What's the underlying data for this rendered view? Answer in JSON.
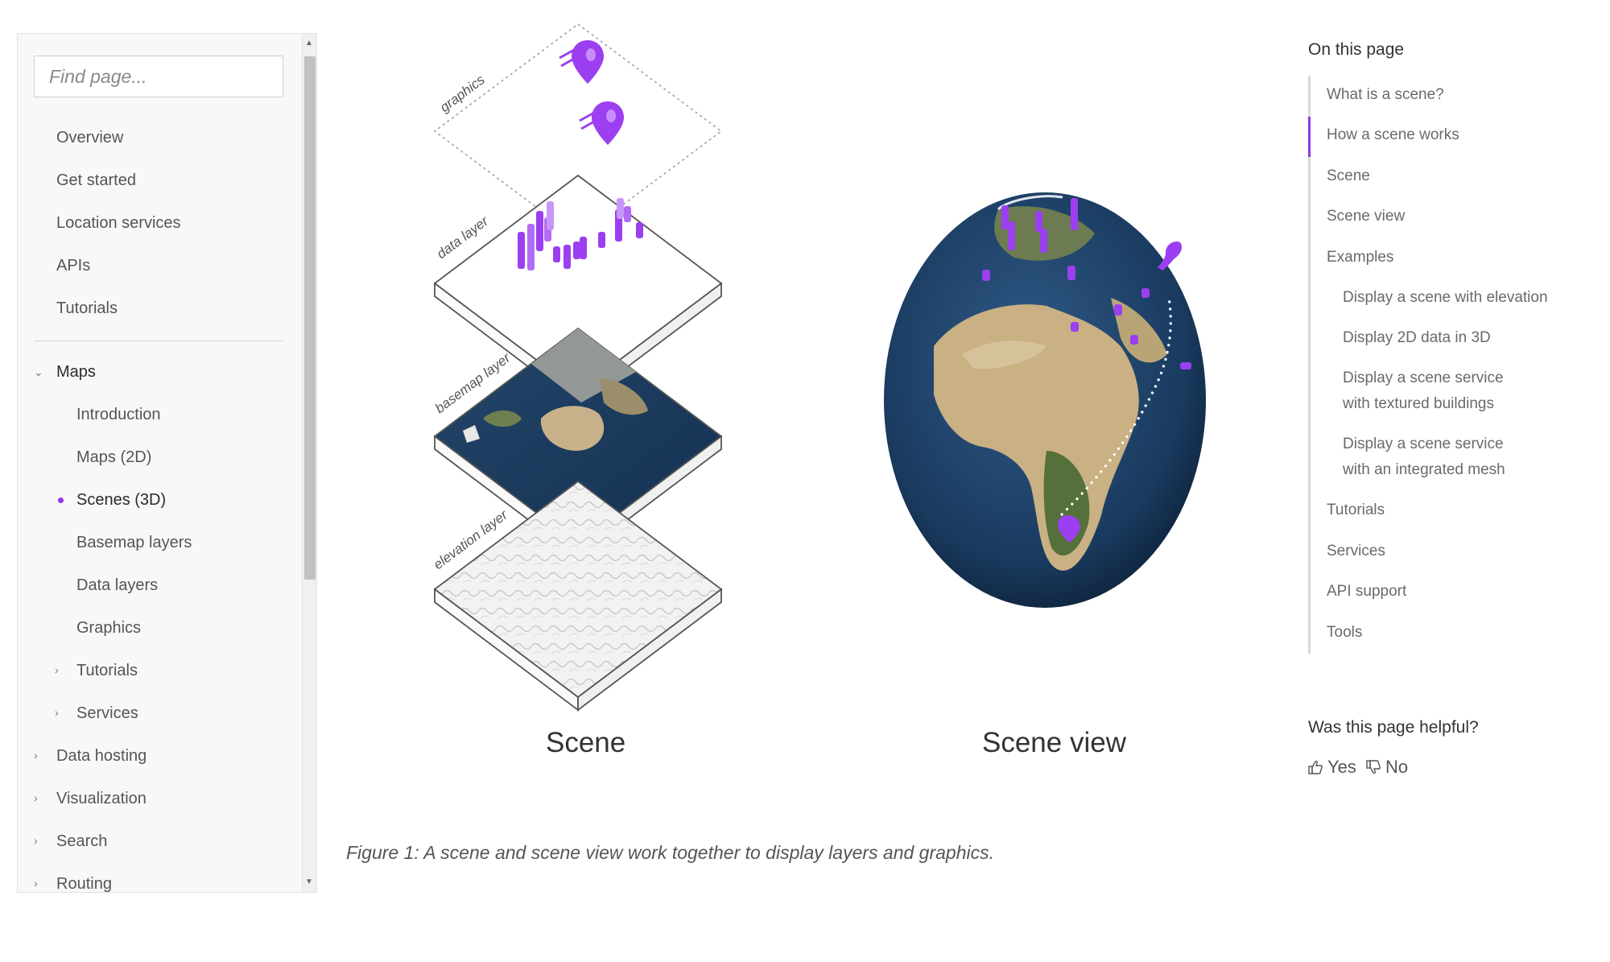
{
  "sidebar": {
    "search_placeholder": "Find page...",
    "top_items": [
      "Overview",
      "Get started",
      "Location services",
      "APIs",
      "Tutorials"
    ],
    "maps_section": {
      "label": "Maps",
      "children": [
        "Introduction",
        "Maps (2D)",
        "Scenes (3D)",
        "Basemap layers",
        "Data layers",
        "Graphics",
        "Tutorials",
        "Services"
      ]
    },
    "bottom_items": [
      "Data hosting",
      "Visualization",
      "Search",
      "Routing"
    ]
  },
  "figure": {
    "layers": [
      "graphics",
      "data layer",
      "basemap layer",
      "elevation layer"
    ],
    "scene_label": "Scene",
    "scene_view_label": "Scene view",
    "caption": "Figure 1: A scene and scene view work together to display layers and graphics."
  },
  "toc": {
    "title": "On this page",
    "items": [
      "What is a scene?",
      "How a scene works",
      "Scene",
      "Scene view",
      "Examples",
      "Display a scene with elevation",
      "Display 2D data in 3D",
      "Display a scene service with textured buildings",
      "Display a scene service with an integrated mesh",
      "Tutorials",
      "Services",
      "API support",
      "Tools"
    ]
  },
  "feedback": {
    "question": "Was this page helpful?",
    "yes": "Yes",
    "no": "No"
  },
  "colors": {
    "accent": "#8f35e6"
  }
}
